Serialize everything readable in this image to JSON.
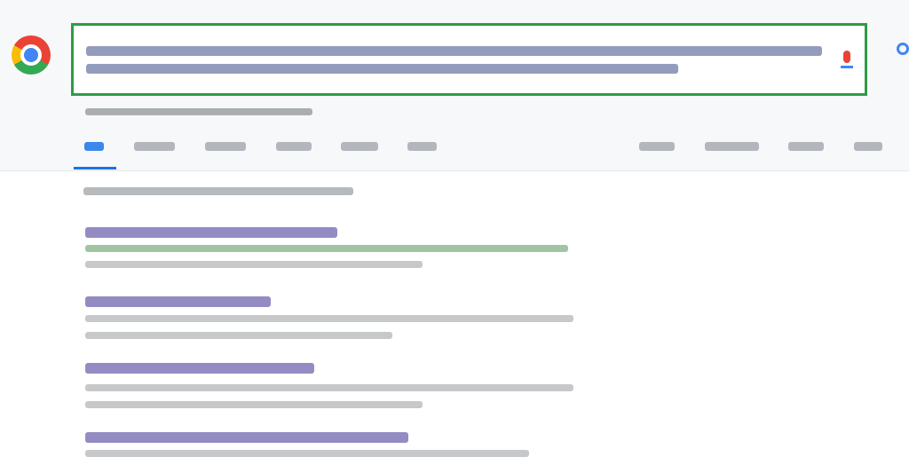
{
  "search": {
    "query": ""
  },
  "tabs": [
    {
      "label": "",
      "active": true
    },
    {
      "label": "",
      "active": false
    },
    {
      "label": "",
      "active": false
    },
    {
      "label": "",
      "active": false
    },
    {
      "label": "",
      "active": false
    },
    {
      "label": "",
      "active": false
    },
    {
      "label": "",
      "active": false
    },
    {
      "label": "",
      "active": false
    },
    {
      "label": "",
      "active": false
    },
    {
      "label": "",
      "active": false
    }
  ],
  "results": [
    {
      "title": ""
    },
    {
      "title": ""
    },
    {
      "title": ""
    },
    {
      "title": ""
    }
  ],
  "colors": {
    "highlight_border": "#2e9b45",
    "link": "#4b3f9b",
    "url": "#2e7d32",
    "active_tab": "#1a73e8"
  }
}
